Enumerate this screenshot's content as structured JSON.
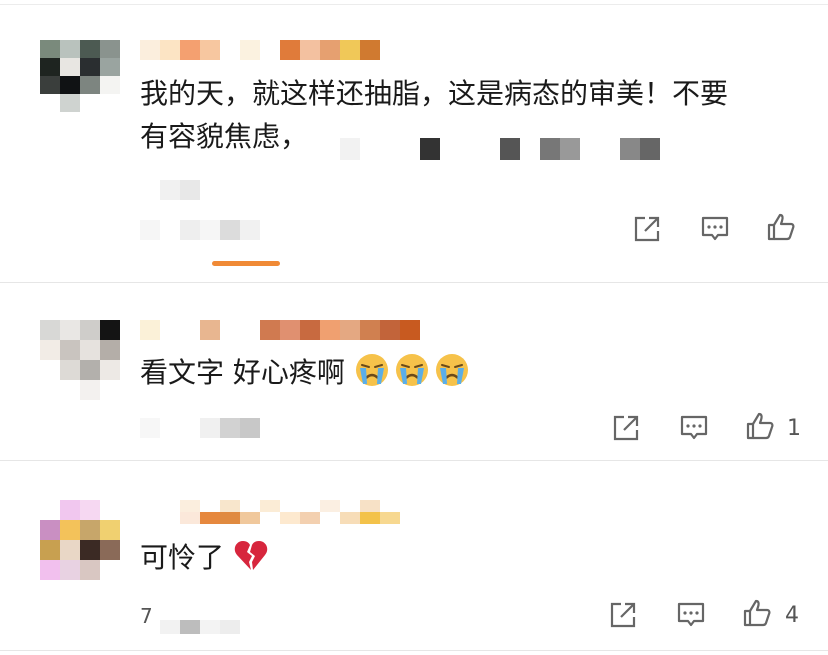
{
  "comments": [
    {
      "text_line1": "我的天，就这样还抽脂，这是病态的审美！不要",
      "text_line2": "有容貌焦虑，",
      "like_count": "",
      "emoji_names": []
    },
    {
      "text": "看文字 好心疼啊",
      "like_count": "1",
      "emoji_names": [
        "loudly-crying-face-icon",
        "loudly-crying-face-icon",
        "loudly-crying-face-icon"
      ]
    },
    {
      "text": "可怜了",
      "like_count": "4",
      "emoji_names": [
        "broken-heart-icon"
      ],
      "timestamp_prefix": "7"
    }
  ],
  "icons": {
    "share": "share-icon",
    "comment": "comment-icon",
    "like": "thumbs-up-icon"
  },
  "colors": {
    "accent_bar": "#f08a36",
    "icon_gray": "#666666",
    "text": "#1a1a1a",
    "broken_heart": "#d7263d"
  }
}
